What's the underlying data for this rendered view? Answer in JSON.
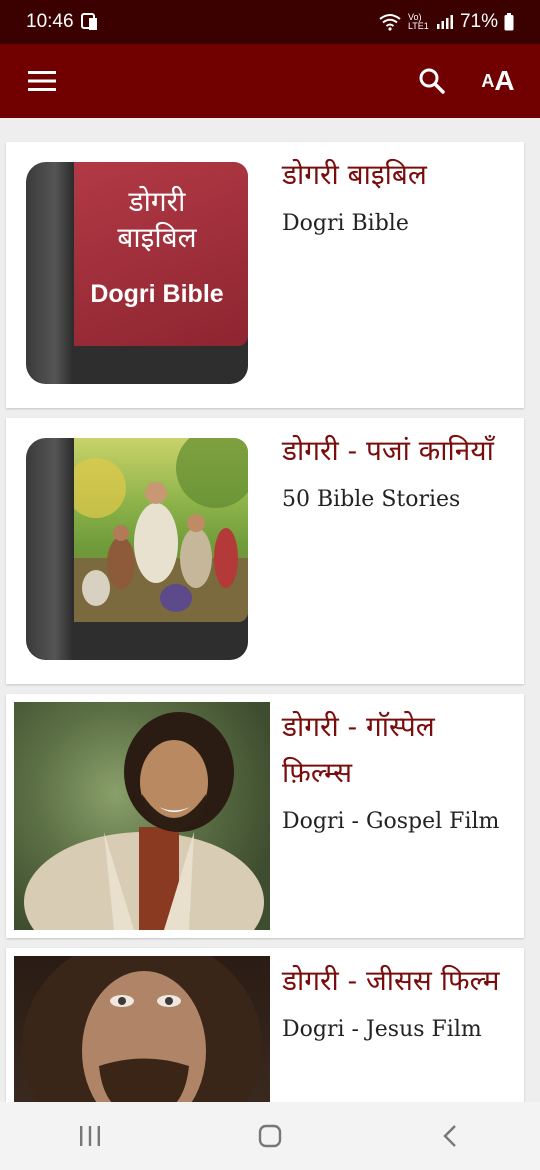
{
  "status_bar": {
    "time": "10:46",
    "network": "Vo) LTE1",
    "battery": "71%"
  },
  "app_bar": {
    "menu_icon": "hamburger-menu-icon",
    "search_icon": "search-icon",
    "font_size_icon": "font-size-icon"
  },
  "items": [
    {
      "title": "डोगरी बाइबिल",
      "subtitle": "Dogri Bible",
      "cover_title": "डोगरी\nबाइबिल",
      "cover_subtitle": "Dogri Bible",
      "thumb": "book-cover-red"
    },
    {
      "title": "डोगरी - पजां कानियाँ",
      "subtitle": "50 Bible Stories",
      "thumb": "book-cover-bible-stories"
    },
    {
      "title": "डोगरी - गॉस्पेल फ़िल्म्स",
      "subtitle": "Dogri - Gospel Film",
      "thumb": "jesus-smiling-photo"
    },
    {
      "title": "डोगरी - जीसस फिल्म",
      "subtitle": "Dogri - Jesus Film",
      "thumb": "jesus-portrait-photo"
    }
  ],
  "colors": {
    "status_bar": "#3b0000",
    "app_bar": "#710000",
    "title_text": "#7a0c0c",
    "background": "#eeeeee"
  }
}
